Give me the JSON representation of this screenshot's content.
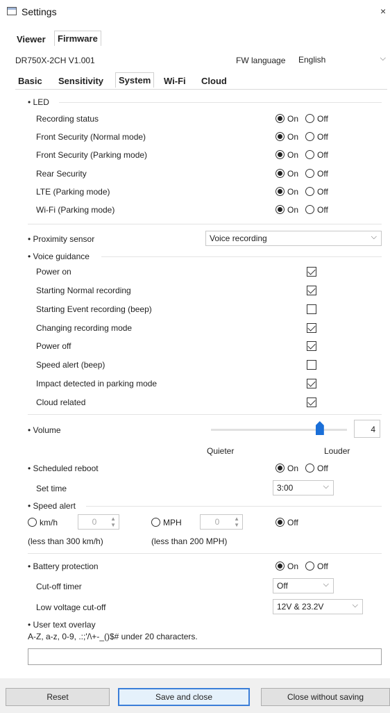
{
  "window": {
    "title": "Settings",
    "close": "×"
  },
  "top_tabs": [
    {
      "label": "Viewer"
    },
    {
      "label": "Firmware"
    }
  ],
  "model": "DR750X-2CH  V1.001",
  "fw_language": {
    "label": "FW language",
    "value": "English"
  },
  "sub_tabs": [
    {
      "label": "Basic"
    },
    {
      "label": "Sensitivity"
    },
    {
      "label": "System"
    },
    {
      "label": "Wi-Fi"
    },
    {
      "label": "Cloud"
    }
  ],
  "on_label": "On",
  "off_label": "Off",
  "led": {
    "header": "• LED",
    "rows": [
      {
        "label": "Recording status",
        "value": "On"
      },
      {
        "label": "Front Security (Normal mode)",
        "value": "On"
      },
      {
        "label": "Front Security (Parking mode)",
        "value": "On"
      },
      {
        "label": "Rear Security",
        "value": "On"
      },
      {
        "label": "LTE (Parking mode)",
        "value": "On"
      },
      {
        "label": "Wi-Fi (Parking mode)",
        "value": "On"
      }
    ]
  },
  "proximity": {
    "label": "• Proximity sensor",
    "value": "Voice recording"
  },
  "voice": {
    "header": "• Voice guidance",
    "items": [
      {
        "label": "Power on",
        "checked": true
      },
      {
        "label": "Starting Normal recording",
        "checked": true
      },
      {
        "label": "Starting Event recording (beep)",
        "checked": false
      },
      {
        "label": "Changing recording mode",
        "checked": true
      },
      {
        "label": "Power off",
        "checked": true
      },
      {
        "label": "Speed alert (beep)",
        "checked": false
      },
      {
        "label": "Impact detected in parking mode",
        "checked": true
      },
      {
        "label": "Cloud related",
        "checked": true
      }
    ]
  },
  "volume": {
    "label": "• Volume",
    "value": "4",
    "level": 0.8,
    "quieter": "Quieter",
    "louder": "Louder"
  },
  "reboot": {
    "label": "• Scheduled reboot",
    "value": "On",
    "set_time_label": "Set time",
    "time": "3:00"
  },
  "speed_alert": {
    "label": "• Speed alert",
    "kmh": "km/h",
    "kmh_value": "0",
    "kmh_note": "(less than 300 km/h)",
    "mph": "MPH",
    "mph_value": "0",
    "mph_note": "(less than 200 MPH)",
    "off": "Off",
    "selected": "Off"
  },
  "battery": {
    "label": "• Battery protection",
    "value": "On",
    "cutoff_label": "Cut-off timer",
    "cutoff_value": "Off",
    "voltage_label": "Low voltage cut-off",
    "voltage_value": "12V & 23.2V"
  },
  "overlay": {
    "label": "• User text overlay",
    "hint": "A-Z, a-z, 0-9, .:;'/\\+-_()$# under 20 characters.",
    "value": ""
  },
  "buttons": {
    "reset": "Reset",
    "save": "Save and close",
    "close": "Close without saving"
  }
}
